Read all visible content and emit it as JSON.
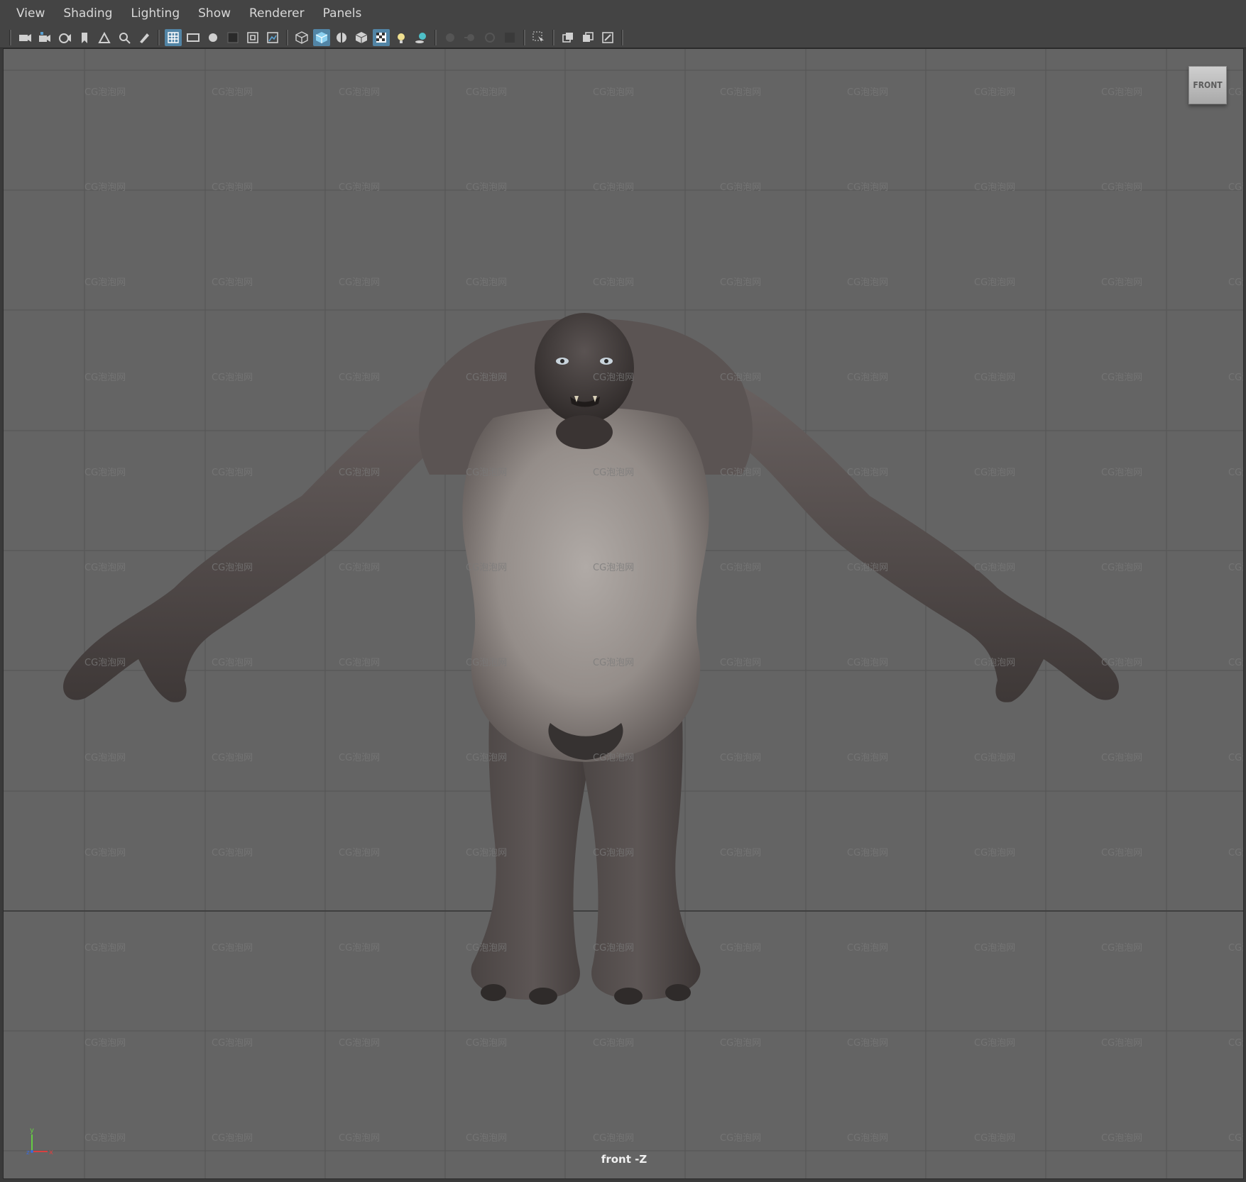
{
  "menu": {
    "items": [
      {
        "label": "View"
      },
      {
        "label": "Shading"
      },
      {
        "label": "Lighting"
      },
      {
        "label": "Show"
      },
      {
        "label": "Renderer"
      },
      {
        "label": "Panels"
      }
    ]
  },
  "toolbar": {
    "groups": [
      [
        "camera-icon",
        "camera-attributes-icon",
        "camera-settings-icon",
        "bookmark-icon",
        "image-plane-icon",
        "2d-pan-zoom-icon",
        "grease-pencil-icon"
      ],
      [
        "grid-icon",
        "film-gate-icon",
        "resolution-gate-icon",
        "gate-mask-icon",
        "field-chart-icon",
        "safe-title-icon"
      ],
      [
        "wireframe-icon",
        "smooth-shade-icon",
        "wireframe-on-shaded-icon",
        "default-material-icon",
        "textured-icon",
        "use-all-lights-icon",
        "shadows-icon"
      ],
      [
        "screen-space-ao-icon",
        "motion-blur-icon",
        "anti-aliasing-icon",
        "depth-of-field-icon"
      ],
      [
        "isolate-select-icon"
      ],
      [
        "xray-icon",
        "xray-joints-icon",
        "xray-active-icon"
      ]
    ],
    "active": [
      "grid-icon",
      "smooth-shade-icon",
      "textured-icon"
    ]
  },
  "viewport": {
    "camera_label": "front -Z",
    "viewcube_label": "FRONT",
    "watermark": "CG泡泡网",
    "axis": {
      "y": "y",
      "z": "z",
      "x": "x"
    },
    "colors": {
      "background": "#646464",
      "grid_line": "#555555",
      "axis_x": "#d94040",
      "axis_y": "#66cc44",
      "axis_z": "#3b6ad9"
    },
    "model": "troll"
  }
}
